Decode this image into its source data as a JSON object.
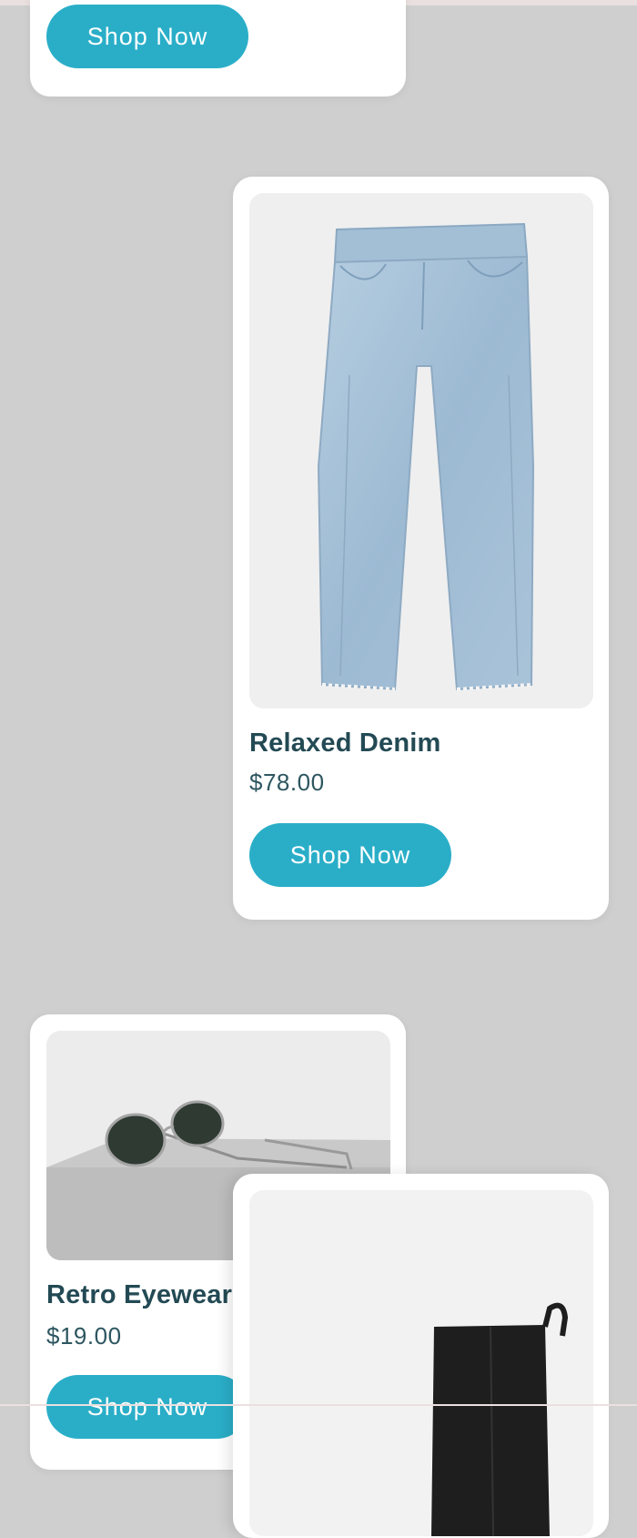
{
  "products": [
    {
      "name": "",
      "price": "",
      "button_label": "Shop Now",
      "image_icon": "product-image"
    },
    {
      "name": "Relaxed Denim",
      "price": "$78.00",
      "button_label": "Shop Now",
      "image_icon": "jeans-image"
    },
    {
      "name": "Retro Eyewear",
      "price": "$19.00",
      "button_label": "Shop Now",
      "image_icon": "sunglasses-image"
    },
    {
      "name": "",
      "price": "",
      "button_label": "",
      "image_icon": "boot-image"
    }
  ],
  "colors": {
    "background": "#cfcfcf",
    "card": "#ffffff",
    "accent_button": "#2aaec8",
    "title": "#234a54",
    "price": "#2d5660"
  }
}
